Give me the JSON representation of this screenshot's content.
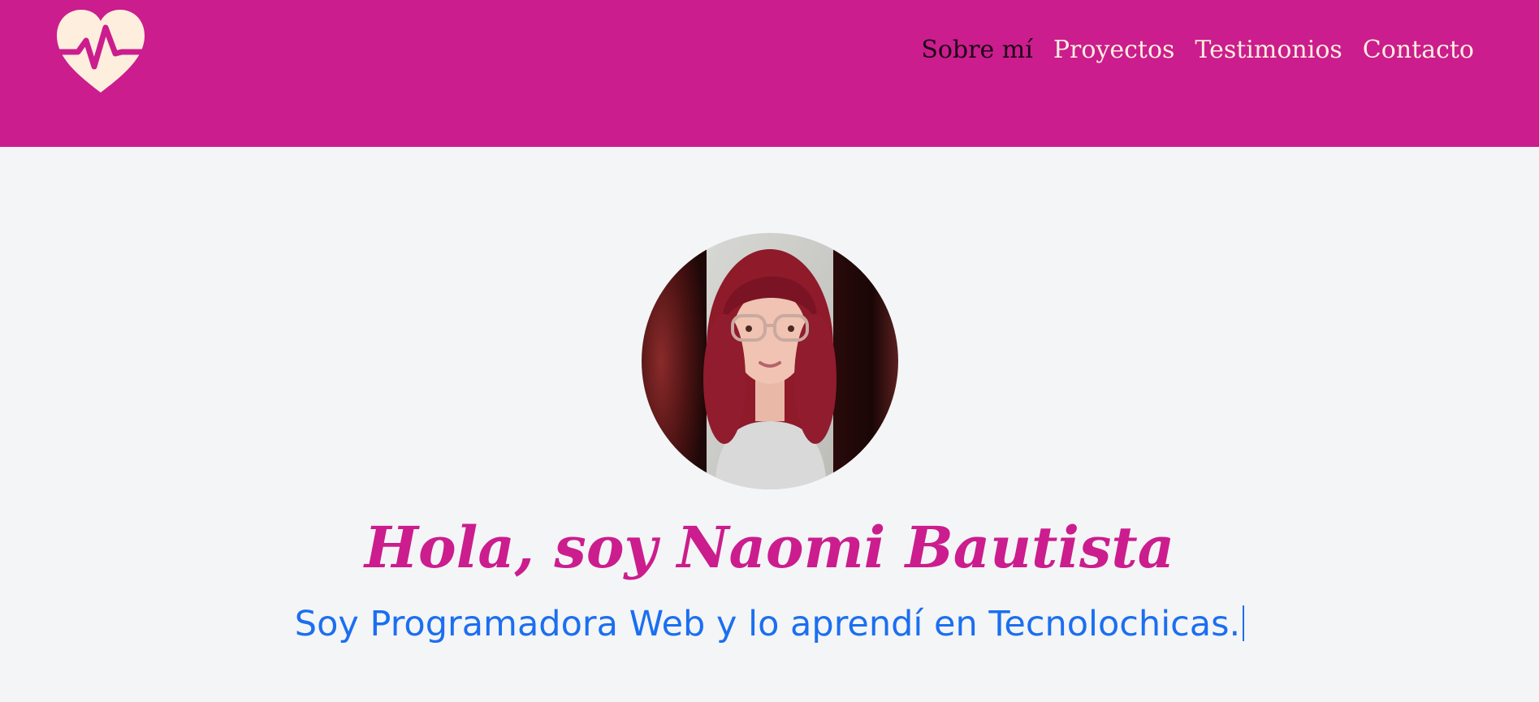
{
  "colors": {
    "header_bg": "#cb1d8d",
    "page_bg": "#f4f5f7",
    "nav_text": "#fdeedd",
    "nav_active_text": "#1d0518",
    "title": "#cb1d8d",
    "subtitle": "#1b6ff0",
    "logo_fill": "#fdeedd"
  },
  "header": {
    "logo_icon": "heart-pulse-icon",
    "nav": [
      {
        "label": "Sobre mí",
        "active": true
      },
      {
        "label": "Proyectos",
        "active": false
      },
      {
        "label": "Testimonios",
        "active": false
      },
      {
        "label": "Contacto",
        "active": false
      }
    ]
  },
  "hero": {
    "title": "Hola, soy Naomi Bautista",
    "subtitle": "Soy Programadora Web y lo aprendí en Tecnolochicas."
  }
}
